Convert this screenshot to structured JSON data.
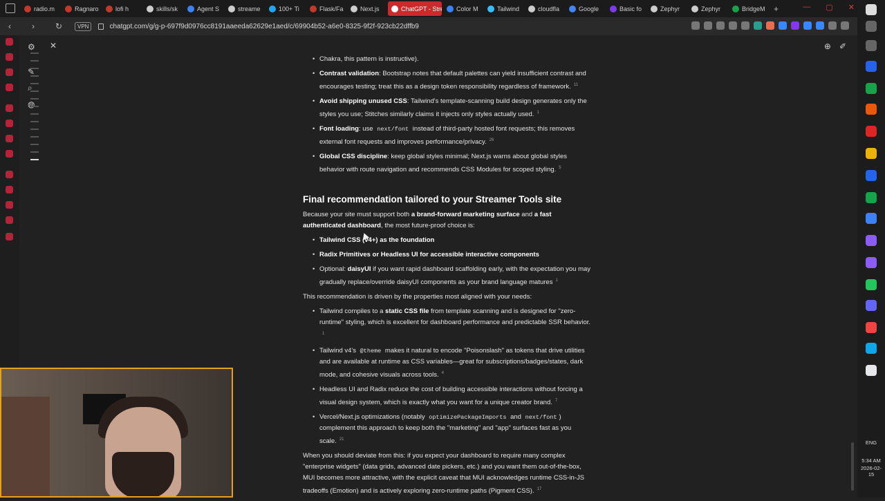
{
  "browser": {
    "tabs": [
      {
        "label": "radio.m",
        "color": "#c0392b"
      },
      {
        "label": "Ragnaro",
        "color": "#c0392b"
      },
      {
        "label": "lofi h",
        "color": "#c0392b"
      },
      {
        "label": "skills/sk",
        "color": "#cccccc"
      },
      {
        "label": "Agent S",
        "color": "#3b82f6"
      },
      {
        "label": "streame",
        "color": "#cccccc"
      },
      {
        "label": "100+ Ti",
        "color": "#22a6f0"
      },
      {
        "label": "Flask/Fa",
        "color": "#c0392b"
      },
      {
        "label": "Next.js",
        "color": "#cccccc"
      },
      {
        "label": "ChatGPT - Stre",
        "color": "#ffffff",
        "active": true
      },
      {
        "label": "Color M",
        "color": "#3b82f6"
      },
      {
        "label": "Tailwind",
        "color": "#38bdf8"
      },
      {
        "label": "cloudfla",
        "color": "#cccccc"
      },
      {
        "label": "Google",
        "color": "#4285f4"
      },
      {
        "label": "Basic fo",
        "color": "#7c3aed"
      },
      {
        "label": "Zephyr",
        "color": "#cccccc"
      },
      {
        "label": "Zephyr",
        "color": "#cccccc"
      },
      {
        "label": "BridgeM",
        "color": "#16a34a"
      }
    ],
    "vpn_label": "VPN",
    "url": "chatgpt.com/g/g-p-697f9d0976cc8191aaeeda62629e1aed/c/69904b52-a6e0-8325-9f2f-923cb22dffb9",
    "accent": "#c92a2a"
  },
  "chat": {
    "items_top": [
      {
        "intro": "",
        "bold": "",
        "text": "Chakra, this pattern is instructive).",
        "cite": ""
      },
      {
        "bold": "Contrast validation",
        "text": ": Bootstrap notes that default palettes can yield insufficient contrast and encourages testing; treat this as a design token responsibility regardless of framework.",
        "cite": "11"
      },
      {
        "bold": "Avoid shipping unused CSS",
        "text": ": Tailwind's template-scanning build design generates only the styles you use; Stitches similarly claims it injects only styles actually used.",
        "cite": "1"
      },
      {
        "bold": "Font loading",
        "text_a": ": use ",
        "code": "next/font",
        "text_b": " instead of third-party hosted font requests; this removes external font requests and improves performance/privacy.",
        "cite": "26"
      },
      {
        "bold": "Global CSS discipline",
        "text": ": keep global styles minimal; Next.js warns about global styles behavior with route navigation and recommends CSS Modules for scoped styling.",
        "cite": "5"
      }
    ],
    "heading": "Final recommendation tailored to your Streamer Tools site",
    "para1": {
      "a": "Because your site must support both ",
      "b1": "a brand-forward marketing surface",
      "c": " and ",
      "b2": "a fast authenticated dashboard",
      "d": ", the most future-proof choice is:"
    },
    "choices": [
      {
        "bold": "Tailwind CSS (v4+) as the foundation",
        "text": "",
        "cite": ""
      },
      {
        "bold": "Radix Primitives or Headless UI for accessible interactive components",
        "text": "",
        "cite": ""
      },
      {
        "pre": "Optional: ",
        "bold": "daisyUI",
        "text": " if you want rapid dashboard scaffolding early, with the expectation you may gradually replace/override daisyUI components as your brand language matures",
        "cite": "1"
      }
    ],
    "para2": "This recommendation is driven by the properties most aligned with your needs:",
    "reasons": [
      {
        "pre": "Tailwind compiles to a ",
        "bold": "static CSS file",
        "text": " from template scanning and is designed for \"zero-runtime\" styling, which is excellent for dashboard performance and predictable SSR behavior.",
        "cite": "1"
      },
      {
        "pre": "Tailwind v4's ",
        "code": "@theme",
        "text": " makes it natural to encode \"Poisonslash\" as tokens that drive utilities and are available at runtime as CSS variables—great for subscriptions/badges/states, dark mode, and cohesive visuals across tools.",
        "cite": "4"
      },
      {
        "pre": "Headless UI and Radix reduce the cost of building accessible interactions without forcing a visual design system, which is exactly what you want for a unique creator brand.",
        "cite": "7"
      },
      {
        "pre": "Vercel/Next.js optimizations (notably ",
        "code": "optimizePackageImports",
        "mid": " and ",
        "code2": "next/font",
        "text": ") complement this approach to keep both the \"marketing\" and \"app\" surfaces fast as you scale.",
        "cite": "21"
      }
    ],
    "para3": "When you should deviate from this: if you expect your dashboard to require many complex \"enterprise widgets\" (data grids, advanced date pickers, etc.) and you want them out-of-the-box, MUI becomes more attractive, with the explicit caveat that MUI acknowledges runtime CSS-in-JS tradeoffs (Emotion) and is actively exploring zero-runtime paths (Pigment CSS).",
    "para3_cite": "17"
  },
  "taskbar": {
    "lang": "ENG",
    "time": "5:34 AM",
    "date": "2026-02-15"
  }
}
